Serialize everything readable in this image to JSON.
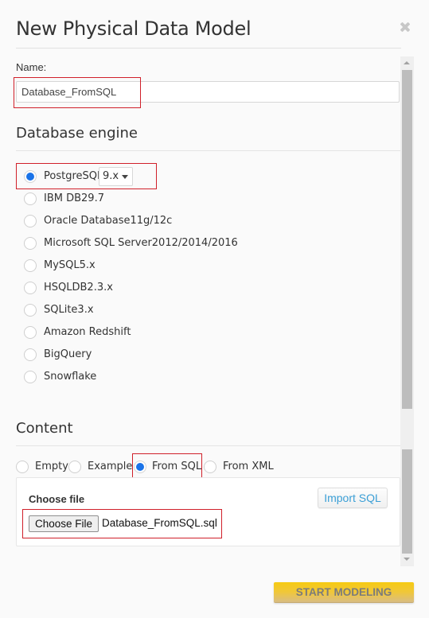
{
  "dialog": {
    "title": "New Physical Data Model",
    "close_icon": "close-icon"
  },
  "name_field": {
    "label": "Name:",
    "value": "Database_FromSQL"
  },
  "database_engine": {
    "heading": "Database engine",
    "options": [
      {
        "label": "PostgreSQL",
        "checked": true,
        "version_select": "9.x"
      },
      {
        "label": "IBM DB29.7",
        "checked": false
      },
      {
        "label": "Oracle Database11g/12c",
        "checked": false
      },
      {
        "label": "Microsoft SQL Server2012/2014/2016",
        "checked": false
      },
      {
        "label": "MySQL5.x",
        "checked": false
      },
      {
        "label": "HSQLDB2.3.x",
        "checked": false
      },
      {
        "label": "SQLite3.x",
        "checked": false
      },
      {
        "label": "Amazon Redshift",
        "checked": false
      },
      {
        "label": "BigQuery",
        "checked": false
      },
      {
        "label": "Snowflake",
        "checked": false
      }
    ]
  },
  "content": {
    "heading": "Content",
    "options": [
      {
        "label": "Empty",
        "checked": false
      },
      {
        "label": "Example",
        "checked": false
      },
      {
        "label": "From SQL",
        "checked": true
      },
      {
        "label": "From XML",
        "checked": false
      }
    ],
    "choose_file_label": "Choose file",
    "import_button": "Import SQL",
    "file_button": "Choose File",
    "file_name": "Database_FromSQL.sql"
  },
  "footer": {
    "start_button": "START MODELING"
  },
  "colors": {
    "accent_radio": "#1a73e8",
    "highlight_box": "#d0202a",
    "import_text": "#3b9fd6",
    "start_button": "#f6ca12"
  }
}
